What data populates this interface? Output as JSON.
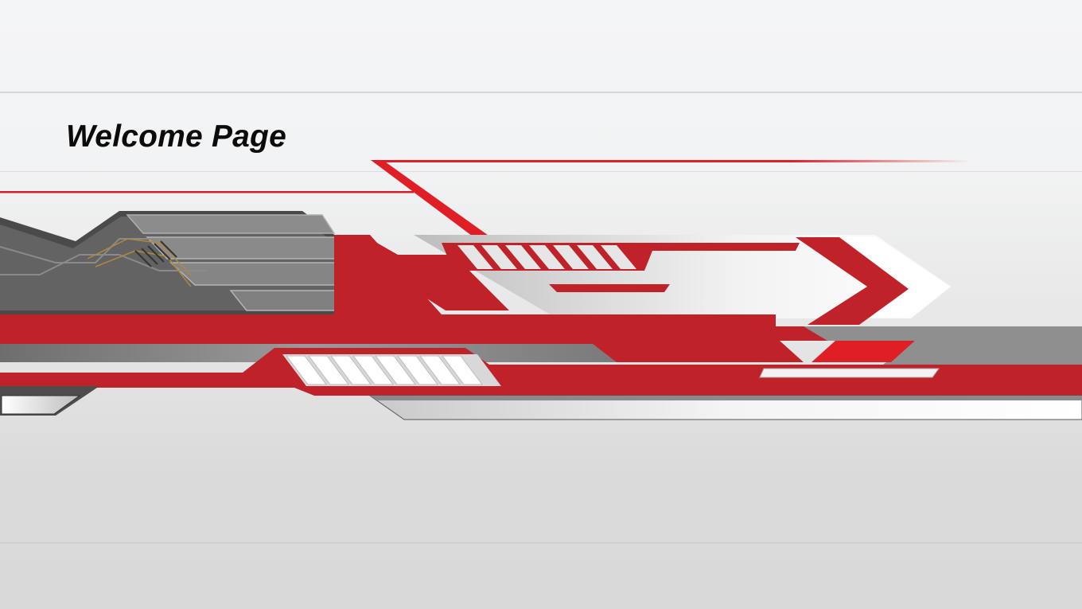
{
  "header": {
    "title": "Welcome Page"
  },
  "theme": {
    "accent_red": "#c0222a",
    "bright_red": "#e01e26",
    "dark_gray": "#555555",
    "light_gray": "#d9d9d9",
    "background": "#f3f4f6"
  },
  "decoration": {
    "style": "red-and-gray-tech-banner",
    "icon": "chevron-right-arrow"
  }
}
